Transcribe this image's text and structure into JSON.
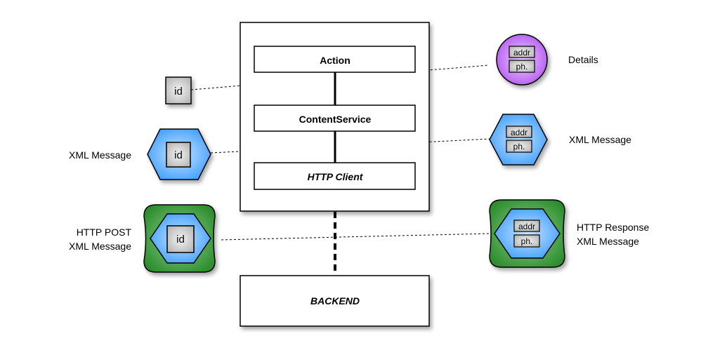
{
  "diagram": {
    "main_components": {
      "action": "Action",
      "content_service": "ContentService",
      "http_client": "HTTP Client"
    },
    "backend": "BACKEND",
    "left": {
      "id_label": "id",
      "xml_message_label": "XML Message",
      "http_post_line1": "HTTP POST",
      "http_post_line2": "XML Message"
    },
    "right": {
      "addr": "addr",
      "ph": "ph.",
      "details_label": "Details",
      "xml_message_label": "XML Message",
      "http_response_line1": "HTTP Response",
      "http_response_line2": "XML Message"
    },
    "colors": {
      "purple": "#c060f0",
      "blue": "#4da6ff",
      "green": "#3a9a3a",
      "grey_box": "#d0d0d0"
    }
  }
}
